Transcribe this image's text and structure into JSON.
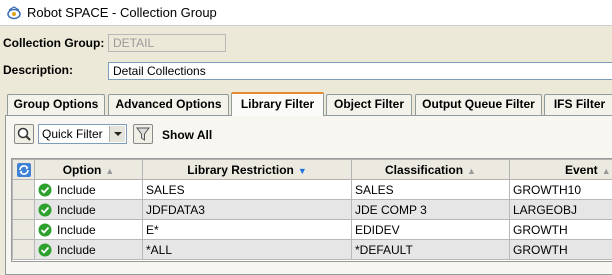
{
  "window": {
    "title": "Robot SPACE - Collection Group",
    "icon": "robot-space-app-icon"
  },
  "form": {
    "collection_group_label": "Collection Group:",
    "collection_group_value": "DETAIL",
    "description_label": "Description:",
    "description_value": "Detail Collections"
  },
  "tabs": [
    {
      "label": "Group Options"
    },
    {
      "label": "Advanced Options"
    },
    {
      "label": "Library Filter",
      "active": true
    },
    {
      "label": "Object Filter"
    },
    {
      "label": "Output Queue Filter"
    },
    {
      "label": "IFS Filter"
    }
  ],
  "toolbar": {
    "search_icon": "search-icon",
    "filter_select": "Quick Filter",
    "funnel_icon": "funnel-icon",
    "show_all_label": "Show All"
  },
  "table": {
    "refresh_icon": "refresh-icon",
    "columns": [
      "Option",
      "Library Restriction",
      "Classification",
      "Event"
    ],
    "sort_arrows": {
      "option": "▲",
      "library": "▼",
      "classification": "▲",
      "event": "▲"
    },
    "rows": [
      {
        "option": "Include",
        "library": "SALES",
        "classification": "SALES",
        "event": "GROWTH10"
      },
      {
        "option": "Include",
        "library": "JDFDATA3",
        "classification": "JDE COMP 3",
        "event": "LARGEOBJ"
      },
      {
        "option": "Include",
        "library": "E*",
        "classification": "EDIDEV",
        "event": "GROWTH"
      },
      {
        "option": "Include",
        "library": "*ALL",
        "classification": "*DEFAULT",
        "event": "GROWTH"
      }
    ]
  },
  "colors": {
    "sort_desc_active": "#1e6fd9",
    "sort_inactive": "#9a9a9a",
    "check": "#2ea02e",
    "tab_highlight": "#e68b2c"
  }
}
